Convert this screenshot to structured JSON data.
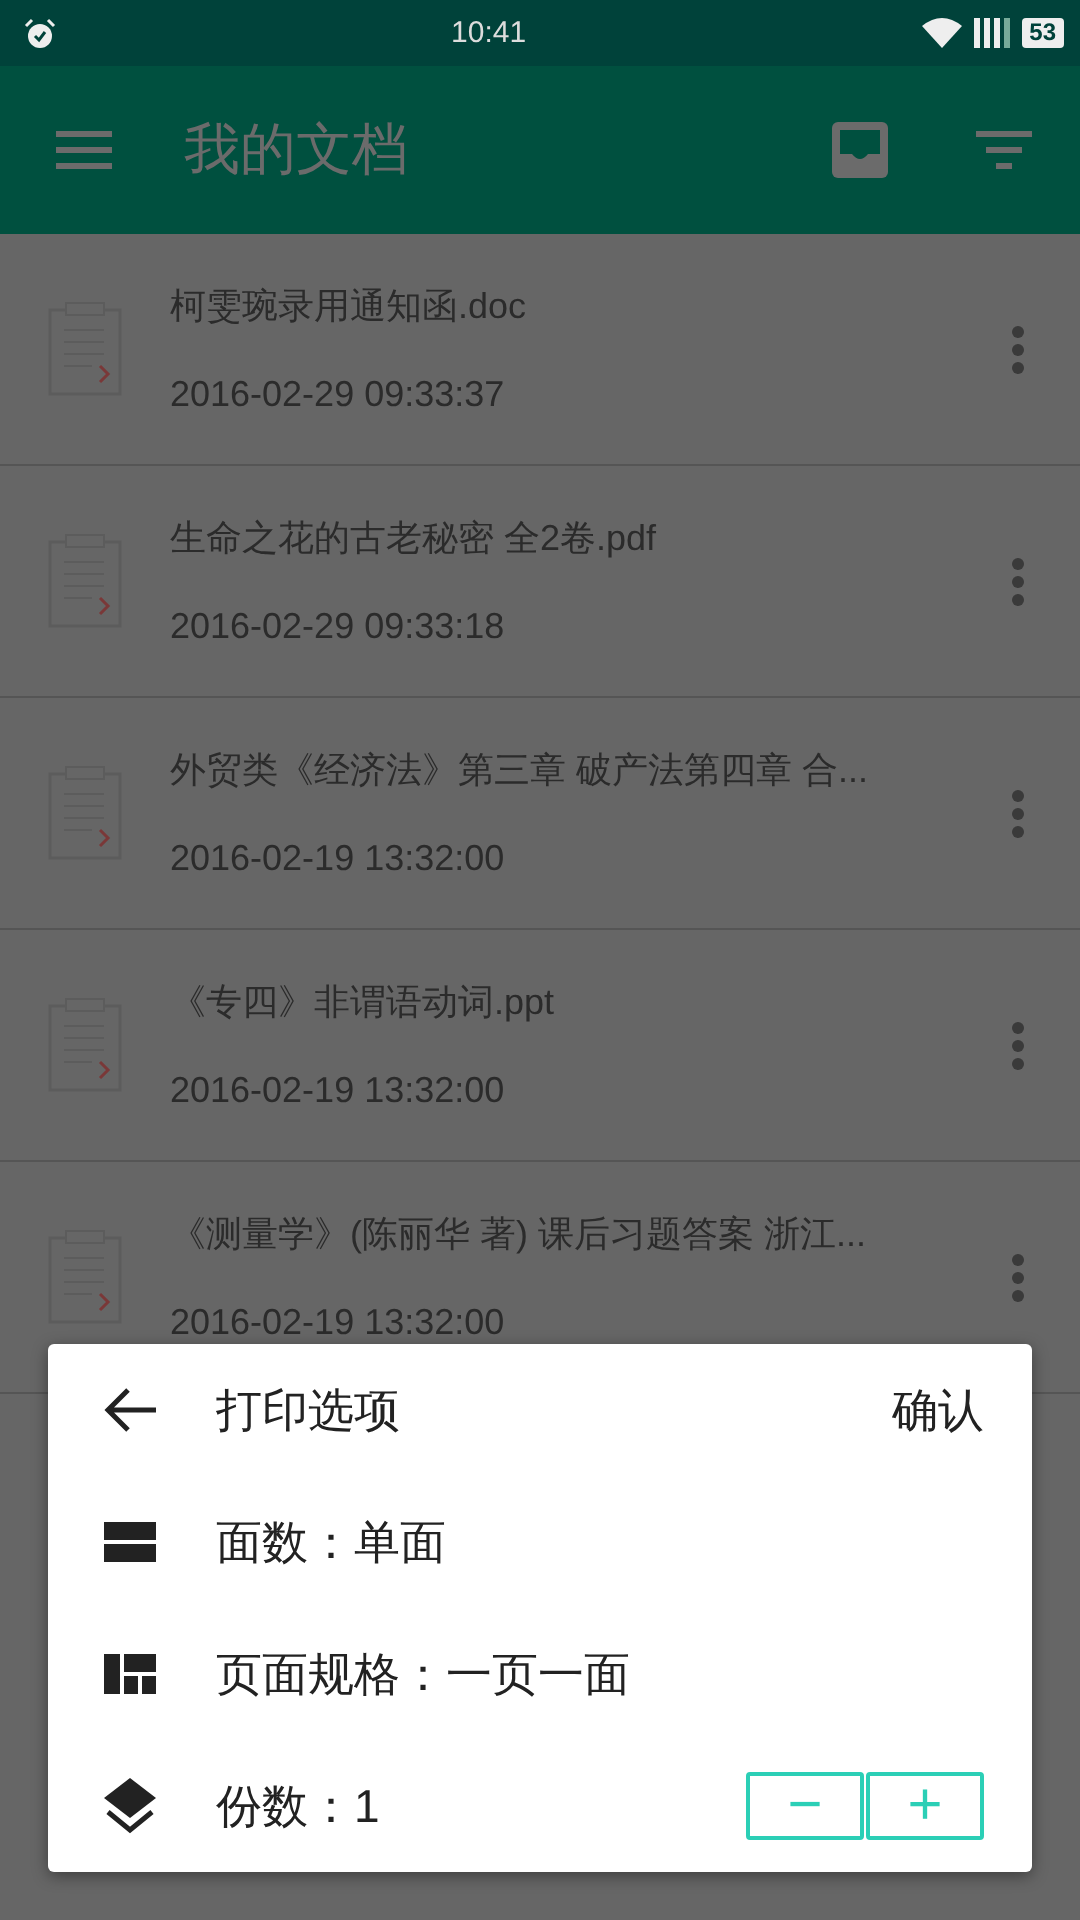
{
  "status_bar": {
    "time": "10:41",
    "battery": "53"
  },
  "app_bar": {
    "title": "我的文档"
  },
  "documents": [
    {
      "name": "柯雯琬录用通知函.doc",
      "date": "2016-02-29 09:33:37"
    },
    {
      "name": "生命之花的古老秘密 全2卷.pdf",
      "date": "2016-02-29 09:33:18"
    },
    {
      "name": "外贸类《经济法》第三章 破产法第四章 合...",
      "date": "2016-02-19 13:32:00"
    },
    {
      "name": "《专四》非谓语动词.ppt",
      "date": "2016-02-19 13:32:00"
    },
    {
      "name": "《测量学》(陈丽华 著) 课后习题答案 浙江...",
      "date": "2016-02-19 13:32:00"
    }
  ],
  "print_dialog": {
    "title": "打印选项",
    "confirm": "确认",
    "options": [
      {
        "kind": "sides",
        "label": "面数：单面"
      },
      {
        "kind": "layout",
        "label": "页面规格：一页一面"
      },
      {
        "kind": "copies",
        "label": "份数：1",
        "decrement": "−",
        "increment": "+"
      }
    ]
  }
}
